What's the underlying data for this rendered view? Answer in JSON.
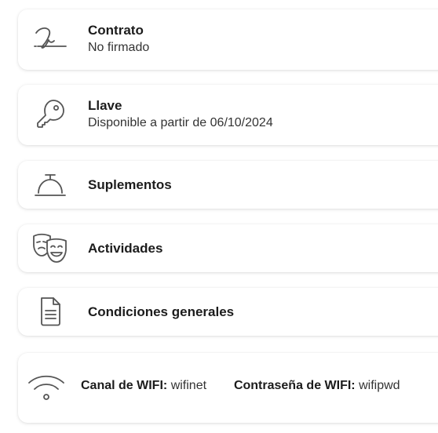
{
  "cards": {
    "contract": {
      "title": "Contrato",
      "subtitle": "No firmado",
      "icon": "signature-icon"
    },
    "key": {
      "title": "Llave",
      "subtitle": "Disponible a partir de 06/10/2024",
      "icon": "key-icon"
    },
    "supplements": {
      "title": "Suplementos",
      "icon": "service-bell-icon"
    },
    "activities": {
      "title": "Actividades",
      "icon": "theater-masks-icon"
    },
    "conditions": {
      "title": "Condiciones generales",
      "icon": "document-icon"
    }
  },
  "wifi": {
    "icon": "wifi-icon",
    "channel_label": "Canal de WIFI:",
    "channel_value": "wifinet",
    "password_label": "Contraseña de WIFI:",
    "password_value": "wifipwd"
  },
  "colors": {
    "icon_stroke": "#555555",
    "card_background": "#ffffff",
    "text_primary": "#1c1c1c"
  }
}
